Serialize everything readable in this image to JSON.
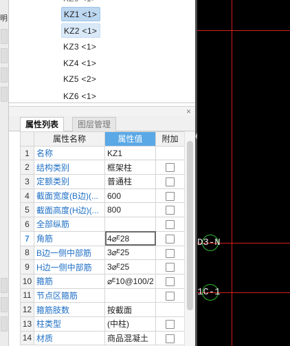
{
  "left_fragment": "明",
  "component_tree": {
    "items": [
      {
        "label": "KZ1 <1>",
        "state": "selected"
      },
      {
        "label": "KZ2 <1>",
        "state": "hover"
      },
      {
        "label": "KZ3 <1>",
        "state": "normal"
      },
      {
        "label": "KZ4 <1>",
        "state": "normal"
      },
      {
        "label": "KZ5 <2>",
        "state": "normal"
      },
      {
        "label": "KZ6 <1>",
        "state": "normal"
      }
    ]
  },
  "panel": {
    "close_glyph": "×",
    "tabs": [
      {
        "label": "属性列表",
        "active": true
      },
      {
        "label": "图层管理",
        "active": false
      }
    ]
  },
  "property_grid": {
    "headers": {
      "num": "",
      "name": "属性名称",
      "value": "属性值",
      "extra": "附加"
    },
    "current_row": 7,
    "rows": [
      {
        "num": "1",
        "name": "名称",
        "value": "KZ1",
        "checkbox": false
      },
      {
        "num": "2",
        "name": "结构类别",
        "value": "框架柱",
        "checkbox": true
      },
      {
        "num": "3",
        "name": "定额类别",
        "value": "普通柱",
        "checkbox": true
      },
      {
        "num": "4",
        "name": "截面宽度(B边)(...",
        "value": "600",
        "checkbox": true
      },
      {
        "num": "5",
        "name": "截面高度(H边)(...",
        "value": "800",
        "checkbox": true
      },
      {
        "num": "6",
        "name": "全部纵筋",
        "value": "",
        "checkbox": true
      },
      {
        "num": "7",
        "name": "角筋",
        "value": "4⌀ᴱ28",
        "checkbox": true
      },
      {
        "num": "8",
        "name": "B边一侧中部筋",
        "value": "3⌀ᴱ25",
        "checkbox": true
      },
      {
        "num": "9",
        "name": "H边一侧中部筋",
        "value": "3⌀ᴱ25",
        "checkbox": true
      },
      {
        "num": "10",
        "name": "箍筋",
        "value": "⌀ᴱ10@100/2",
        "checkbox": true
      },
      {
        "num": "11",
        "name": "节点区箍筋",
        "value": "",
        "checkbox": true
      },
      {
        "num": "12",
        "name": "箍筋肢数",
        "value": "按截面",
        "checkbox": false
      },
      {
        "num": "13",
        "name": "柱类型",
        "value": "(中柱)",
        "checkbox": true
      },
      {
        "num": "14",
        "name": "材质",
        "value": "商品混凝土",
        "checkbox": true
      }
    ]
  },
  "canvas": {
    "background": "#000000",
    "grid_line_color": "#d6201e",
    "axis_circle_color": "#2fbf2f",
    "axis_labels": [
      "D3-N",
      "1C-1"
    ]
  }
}
